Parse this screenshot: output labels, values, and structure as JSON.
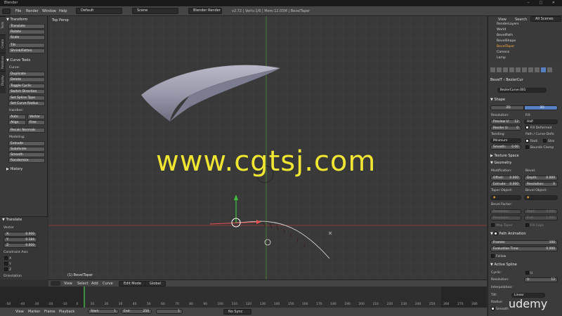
{
  "window": {
    "title": "Blender"
  },
  "menu": {
    "items": [
      "File",
      "Render",
      "Window",
      "Help"
    ],
    "layout": "Default",
    "scene": "Scene",
    "engine": "Blender Render",
    "stats": "v2.72 | Verts:1/6 | Mem:12.05M | BevelTaper"
  },
  "toolshelf": {
    "tabs": [
      "Tools",
      "Create",
      "Relations",
      "Display",
      "Grease Pencil"
    ],
    "transform_header": "Transform",
    "transform_buttons": [
      "Translate",
      "Rotate",
      "Scale",
      "Tilt",
      "Shrink/Fatten"
    ],
    "curve_tools_header": "Curve Tools",
    "curve_label": "Curve:",
    "curve_buttons": [
      "Duplicate",
      "Delete",
      "Toggle Cyclic",
      "Switch Direction",
      "Set Spline Type",
      "Set Curve Radius"
    ],
    "handles_label": "Handles:",
    "handles_buttons": [
      "Auto",
      "Vector",
      "Align",
      "Free"
    ],
    "recalc_normals": "Recalc Normals",
    "modeling_label": "Modeling:",
    "modeling_buttons": [
      "Extrude",
      "Subdivide",
      "Smooth",
      "Randomize"
    ],
    "history_header": "History"
  },
  "operator_panel": {
    "header": "Translate",
    "vector_label": "Vector",
    "x": "X:",
    "x_val": "0.000",
    "y": "Y:",
    "y_val": "0.184",
    "z": "Z:",
    "z_val": "0.000",
    "constraint_label": "Constraint Axis",
    "axes": [
      "X",
      "Y",
      "Z"
    ],
    "orientation": "Orientation"
  },
  "viewport": {
    "view_label": "Top Persp",
    "object_label": "(1) BevelTaper"
  },
  "viewport_header": {
    "items": [
      "View",
      "Select",
      "Add",
      "Curve"
    ],
    "mode": "Edit Mode",
    "orientation": "Global"
  },
  "timeline": {
    "ticks": [
      "-50",
      "-40",
      "-30",
      "-20",
      "-10",
      "0",
      "10",
      "20",
      "30",
      "40",
      "50",
      "60",
      "70",
      "80",
      "90",
      "100",
      "110",
      "120",
      "130",
      "140",
      "150",
      "160",
      "170",
      "180",
      "190",
      "200",
      "210",
      "220",
      "230",
      "240",
      "250",
      "260",
      "270",
      "280"
    ],
    "menu": [
      "View",
      "Marker",
      "Frame",
      "Playback"
    ],
    "start_label": "Start:",
    "start": "1",
    "end_label": "End:",
    "end": "250",
    "current": "1",
    "sync": "No Sync"
  },
  "outliner": {
    "menu": [
      "View",
      "Search"
    ],
    "filter": "All Scenes",
    "items": [
      "RenderLayers",
      "World",
      "BevelPath",
      "BevelShape",
      "BevelTaper",
      "Camera",
      "Lamp"
    ]
  },
  "properties": {
    "breadcrumb": [
      "BevelT",
      "BezierCur"
    ],
    "data_name": "BezierCurve.001",
    "shape_header": "Shape",
    "dims": [
      "2D",
      "3D"
    ],
    "resolution_label": "Resolution:",
    "fill_label": "Fill:",
    "preview_u": "Preview U:",
    "preview_u_val": "12",
    "fill_val": "Half",
    "render_u": "Render U:",
    "render_u_val": "0",
    "fill_deformed": "Fill Deformed",
    "twisting_label": "Twisting:",
    "path_deform_label": "Path / Curve-Defo",
    "twist_val": "Minimum",
    "radius_chk": "Radi",
    "stretch_chk": "Stre",
    "smooth_label": "Smooth:",
    "smooth_val": "0.00",
    "bounds_clamp": "Bounds Clamp",
    "texture_space": "Texture Space",
    "geometry_header": "Geometry",
    "modification_label": "Modification:",
    "bevel_label": "Bevel:",
    "offset": "Offset:",
    "offset_val": "0.000",
    "depth": "Depth:",
    "depth_val": "0.000",
    "extrude": "Extrude:",
    "extrude_val": "0.000",
    "resolution2": "Resolution:",
    "resolution2_val": "0",
    "taper_object": "Taper Object:",
    "bevel_object": "Bevel Object:",
    "bevel_factor": "Bevel Factor:",
    "res_label": "Resolution",
    "start_label": "Start:",
    "start_val": "0.000",
    "end_label": "End:",
    "end_val": "1.000",
    "map_taper": "Map Taper",
    "fill_caps": "Fill Caps",
    "path_animation": "Path Animation",
    "frames": "Frames:",
    "frames_val": "100",
    "eval_time": "Evaluation Time:",
    "eval_time_val": "0.000",
    "follow": "Follow",
    "active_spline": "Active Spline",
    "cyclic_label": "Cyclic:",
    "cyclic_u": "U",
    "resolution3": "Resolution:",
    "u_label": "U:",
    "u_val": "12",
    "interpolation": "Interpolation:",
    "tilt_label": "Tilt:",
    "tilt_val": "Linear",
    "radius_label": "Radius:",
    "smooth_chk": "Smooth"
  },
  "watermark": {
    "text": "www.cgtsj.com",
    "color": "#f0e632"
  },
  "brand": {
    "text": "udemy"
  }
}
